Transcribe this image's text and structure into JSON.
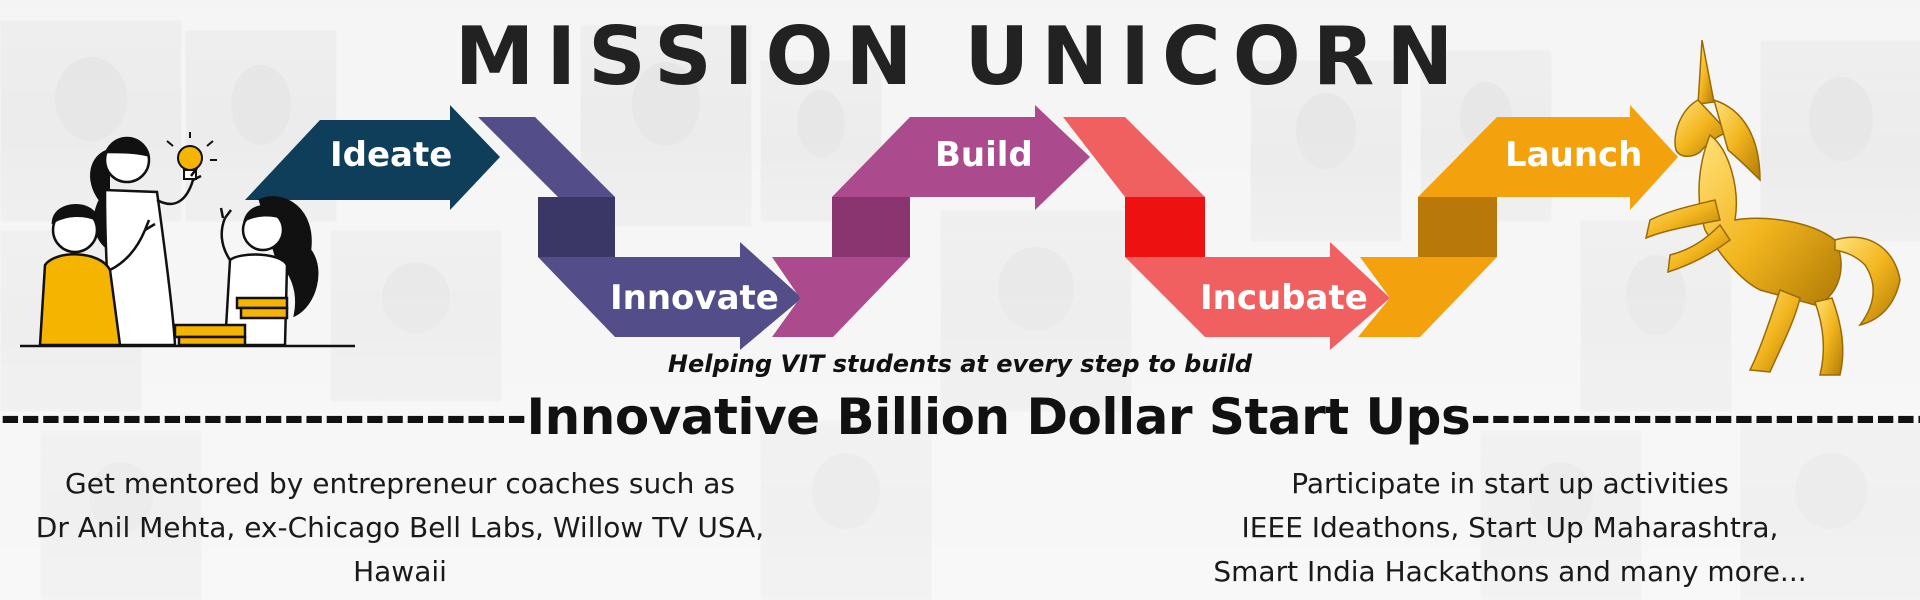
{
  "title": "MISSION UNICORN",
  "steps": [
    {
      "label": "Ideate",
      "color": "#0e3e5a"
    },
    {
      "label": "Innovate",
      "color": "#534e8a"
    },
    {
      "label": "Build",
      "color": "#ab4a8c"
    },
    {
      "label": "Incubate",
      "color": "#f06060"
    },
    {
      "label": "Launch",
      "color": "#f3a10d"
    }
  ],
  "tagline": "Helping VIT students at every step to build",
  "headline": "--------------------------Innovative Billion Dollar Start Ups--------------------------",
  "left_block": {
    "lines": [
      "Get mentored by entrepreneur coaches such as",
      "Dr Anil Mehta, ex-Chicago Bell Labs, Willow TV USA,",
      "Hawaii"
    ]
  },
  "right_block": {
    "lines": [
      "Participate in start up activities",
      "IEEE Ideathons, Start Up Maharashtra,",
      "Smart India Hackathons and many more..."
    ]
  },
  "icons": {
    "people": "students-brainstorming-illustration",
    "unicorn": "golden-unicorn-illustration",
    "bulb": "lightbulb-icon"
  }
}
